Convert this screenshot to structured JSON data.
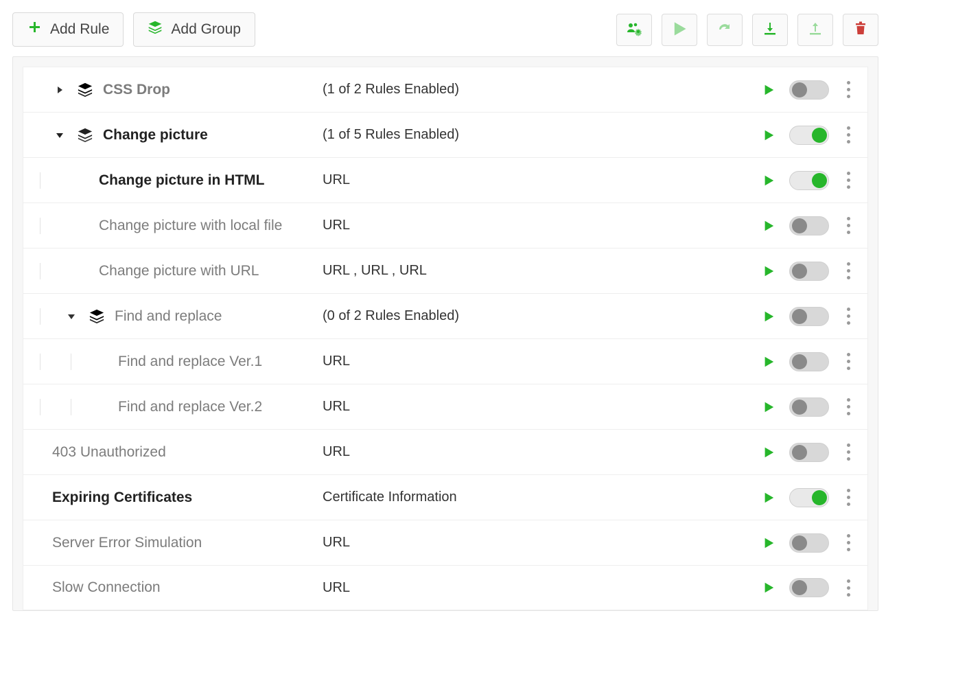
{
  "toolbar": {
    "add_rule_label": "Add Rule",
    "add_group_label": "Add Group"
  },
  "rows": {
    "css_drop": {
      "title": "CSS Drop",
      "info": "(1 of 2 Rules Enabled)"
    },
    "change_picture": {
      "title": "Change picture",
      "info": "(1 of 5 Rules Enabled)"
    },
    "change_html": {
      "title": "Change picture in HTML",
      "info": "URL"
    },
    "change_local": {
      "title": "Change picture with local file",
      "info": "URL"
    },
    "change_url": {
      "title": "Change picture with URL",
      "info": "URL , URL , URL"
    },
    "find_replace": {
      "title": "Find and replace",
      "info": "(0 of 2 Rules Enabled)"
    },
    "fr_v1": {
      "title": "Find and replace Ver.1",
      "info": "URL"
    },
    "fr_v2": {
      "title": "Find and replace Ver.2",
      "info": "URL"
    },
    "unauthorized": {
      "title": "403 Unauthorized",
      "info": "URL"
    },
    "expiring_certs": {
      "title": "Expiring Certificates",
      "info": "Certificate Information"
    },
    "server_error": {
      "title": "Server Error Simulation",
      "info": "URL"
    },
    "slow_conn": {
      "title": "Slow Connection",
      "info": "URL"
    }
  }
}
